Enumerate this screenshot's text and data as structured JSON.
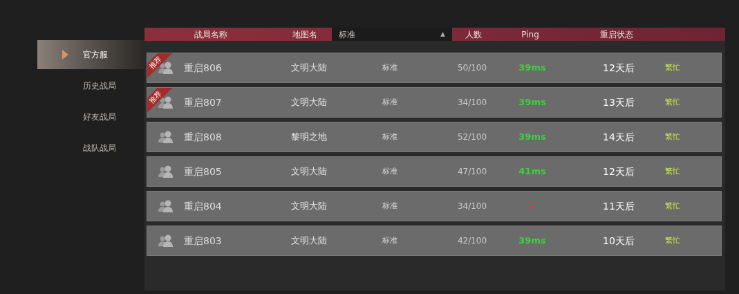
{
  "sidebar": {
    "items": [
      {
        "label": "官方服",
        "selected": true
      },
      {
        "label": "历史战局",
        "selected": false
      },
      {
        "label": "好友战局",
        "selected": false
      },
      {
        "label": "战队战局",
        "selected": false
      }
    ]
  },
  "table": {
    "columns": [
      {
        "kind": "label",
        "text": "战局名称"
      },
      {
        "kind": "label",
        "text": "地图名"
      },
      {
        "kind": "dropdown",
        "text": "标准",
        "arrow": "▲"
      },
      {
        "kind": "label",
        "text": "人数"
      },
      {
        "kind": "label",
        "text": "Ping"
      },
      {
        "kind": "label",
        "text": "重启状态"
      }
    ],
    "rows": [
      {
        "badge": "推荐",
        "name": "重启806",
        "map": "文明大陆",
        "mode": "标准",
        "players": "50/100",
        "ping": {
          "text": "39ms",
          "color": "#3ecf3e"
        },
        "restart": "12天后",
        "status": "繁忙"
      },
      {
        "badge": "推荐",
        "name": "重启807",
        "map": "文明大陆",
        "mode": "标准",
        "players": "34/100",
        "ping": {
          "text": "39ms",
          "color": "#3ecf3e"
        },
        "restart": "13天后",
        "status": "繁忙"
      },
      {
        "name": "重启808",
        "map": "黎明之地",
        "mode": "标准",
        "players": "52/100",
        "ping": {
          "text": "39ms",
          "color": "#3ecf3e"
        },
        "restart": "14天后",
        "status": "繁忙"
      },
      {
        "name": "重启805",
        "map": "文明大陆",
        "mode": "标准",
        "players": "47/100",
        "ping": {
          "text": "41ms",
          "color": "#3ecf3e"
        },
        "restart": "12天后",
        "status": "繁忙"
      },
      {
        "name": "重启804",
        "map": "文明大陆",
        "mode": "标准",
        "players": "34/100",
        "ping": {
          "text": "–",
          "color": "#ff2a2a"
        },
        "restart": "11天后",
        "status": "繁忙"
      },
      {
        "name": "重启803",
        "map": "文明大陆",
        "mode": "标准",
        "players": "42/100",
        "ping": {
          "text": "39ms",
          "color": "#3ecf3e"
        },
        "restart": "10天后",
        "status": "繁忙"
      }
    ]
  }
}
